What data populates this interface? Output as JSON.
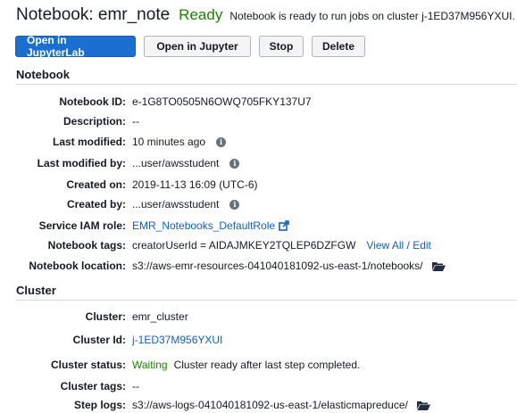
{
  "header": {
    "title": "Notebook: emr_note",
    "status": "Ready",
    "status_message": "Notebook is ready to run jobs on cluster j-1ED37M956YXUI."
  },
  "toolbar": {
    "open_jupyterlab": "Open in JupyterLab",
    "open_jupyter": "Open in Jupyter",
    "stop": "Stop",
    "delete": "Delete"
  },
  "notebook": {
    "section_title": "Notebook",
    "id_label": "Notebook ID:",
    "id": "e-1G8TO0505N6OWQ705FKY137U7",
    "description_label": "Description:",
    "description": "--",
    "last_modified_label": "Last modified:",
    "last_modified": "10 minutes ago",
    "last_modified_by_label": "Last modified by:",
    "last_modified_by": "...user/awsstudent",
    "created_on_label": "Created on:",
    "created_on": "2019-11-13 16:09 (UTC-6)",
    "created_by_label": "Created by:",
    "created_by": "...user/awsstudent",
    "service_role_label": "Service IAM role:",
    "service_role": "EMR_Notebooks_DefaultRole",
    "tags_label": "Notebook tags:",
    "tags": "creatorUserId = AIDAJMKEY2TQLEP6DZFGW",
    "tags_link": "View All / Edit",
    "location_label": "Notebook location:",
    "location": "s3://aws-emr-resources-041040181092-us-east-1/notebooks/"
  },
  "cluster": {
    "section_title": "Cluster",
    "cluster_label": "Cluster:",
    "cluster": "emr_cluster",
    "cluster_id_label": "Cluster Id:",
    "cluster_id": "j-1ED37M956YXUI",
    "status_label": "Cluster status:",
    "status": "Waiting",
    "status_message": "Cluster ready after last step completed.",
    "tags_label": "Cluster tags:",
    "tags": "--",
    "step_logs_label": "Step logs:",
    "step_logs": "s3://aws-logs-041040181092-us-east-1/elasticmapreduce/"
  },
  "icons": {
    "info": "info-icon",
    "external_link": "external-link-icon",
    "folder": "folder-open-icon"
  },
  "colors": {
    "primary_button": "#1a6fd1",
    "link": "#0b5fcb",
    "success": "#1d8102"
  }
}
